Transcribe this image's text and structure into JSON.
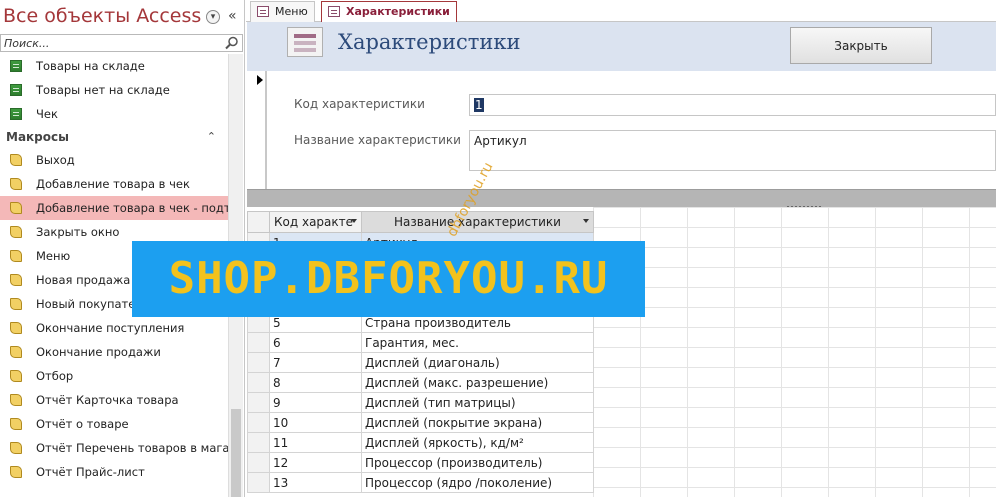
{
  "nav": {
    "title": "Все объекты Access",
    "search_placeholder": "Поиск...",
    "tables": [
      "Товары на складе",
      "Товары нет на складе",
      "Чек"
    ],
    "macros_group": "Макросы",
    "macros": [
      "Выход",
      "Добавление товара в чек",
      "Добавление товара в чек - подтв",
      "Закрыть окно",
      "Меню",
      "Новая продажа",
      "Новый покупатель",
      "Окончание поступления",
      "Окончание продажи",
      "Отбор",
      "Отчёт Карточка товара",
      "Отчёт о товаре",
      "Отчёт Перечень товаров в мага...",
      "Отчёт Прайс-лист"
    ],
    "selected_macro": "Добавление товара в чек - подтв"
  },
  "tabs": [
    {
      "label": "Меню"
    },
    {
      "label": "Характеристики"
    }
  ],
  "form": {
    "title": "Характеристики",
    "close_label": "Закрыть",
    "code_label": "Код характеристики",
    "code_value": "1",
    "name_label": "Название характеристики",
    "name_value": "Артикул"
  },
  "datasheet": {
    "columns": [
      "Код характе",
      "Название характеристики"
    ],
    "rows": [
      {
        "code": "1",
        "name": "Артикул"
      },
      {
        "code": "",
        "name": ""
      },
      {
        "code": "",
        "name": ""
      },
      {
        "code": "",
        "name": ""
      },
      {
        "code": "5",
        "name": "Страна производитель"
      },
      {
        "code": "6",
        "name": "Гарантия, мес."
      },
      {
        "code": "7",
        "name": "Дисплей (диагональ)"
      },
      {
        "code": "8",
        "name": "Дисплей (макс. разрешение)"
      },
      {
        "code": "9",
        "name": "Дисплей (тип матрицы)"
      },
      {
        "code": "10",
        "name": "Дисплей (покрытие экрана)"
      },
      {
        "code": "11",
        "name": "Дисплей (яркость), кд/м²"
      },
      {
        "code": "12",
        "name": "Процессор (производитель)"
      },
      {
        "code": "13",
        "name": "Процессор (ядро /поколение)"
      }
    ]
  },
  "watermark": {
    "banner": "SHOP.DBFORYOU.RU",
    "diagonal": "dbforyou.ru"
  },
  "colors": {
    "nav_title": "#a4373a",
    "selected_item": "#f4b8b8",
    "form_header_bg": "#dbe3f0",
    "banner_bg": "#1c9ff0",
    "banner_text": "#f2c21d"
  }
}
